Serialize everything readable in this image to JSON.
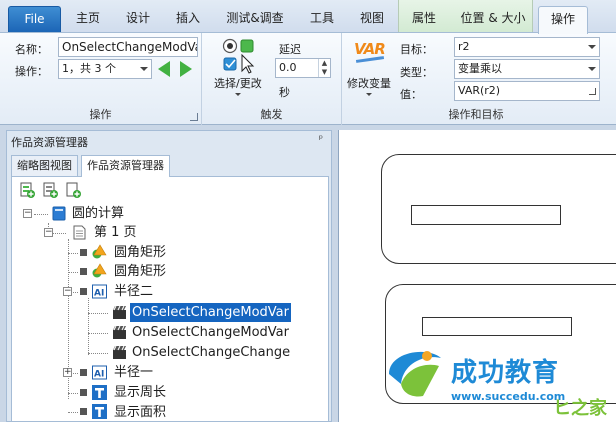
{
  "ribbon": {
    "file_tab": "File",
    "tabs": [
      "主页",
      "设计",
      "插入",
      "测试&调查",
      "工具",
      "视图",
      "属性",
      "位置 & 大小",
      "操作"
    ],
    "active_tab": "操作",
    "groups": {
      "action": {
        "label": "操作",
        "name_label": "名称：",
        "name_value": "OnSelectChangeModVar",
        "op_label": "操作：",
        "op_value": "1，共 3 个"
      },
      "trigger": {
        "label": "触发",
        "select_change_label": "选择/更改",
        "delay_label": "延迟",
        "delay_value": "0.0",
        "delay_unit": "秒"
      },
      "op_target": {
        "label": "操作和目标",
        "modify_var_label": "修改变量",
        "var_icon_text": "VAR",
        "target_label": "目标：",
        "target_value": "r2",
        "type_label": "类型：",
        "type_value": "变量乘以",
        "value_label": "值：",
        "value_value": "VAR(r2)"
      }
    }
  },
  "pane": {
    "title": "作品资源管理器",
    "pin": "ᵖ",
    "tabs": [
      "缩略图视图",
      "作品资源管理器"
    ],
    "active_tab": "作品资源管理器",
    "tree": [
      {
        "label": "圆的计算"
      },
      {
        "label": "第 1 页"
      },
      {
        "label": "圆角矩形"
      },
      {
        "label": "圆角矩形"
      },
      {
        "label": "半径二"
      },
      {
        "label": "OnSelectChangeModVar",
        "selected": true
      },
      {
        "label": "OnSelectChangeModVar"
      },
      {
        "label": "OnSelectChangeChange"
      },
      {
        "label": "半径一"
      },
      {
        "label": "显示周长"
      },
      {
        "label": "显示面积"
      }
    ]
  },
  "watermark": {
    "brand": "成功教育",
    "url": "www.succedu.com",
    "corner_text": "ヒ之家"
  },
  "colors": {
    "file_tab": "#1c65b6",
    "selection": "#1565c0",
    "accent_green": "#42b142"
  }
}
